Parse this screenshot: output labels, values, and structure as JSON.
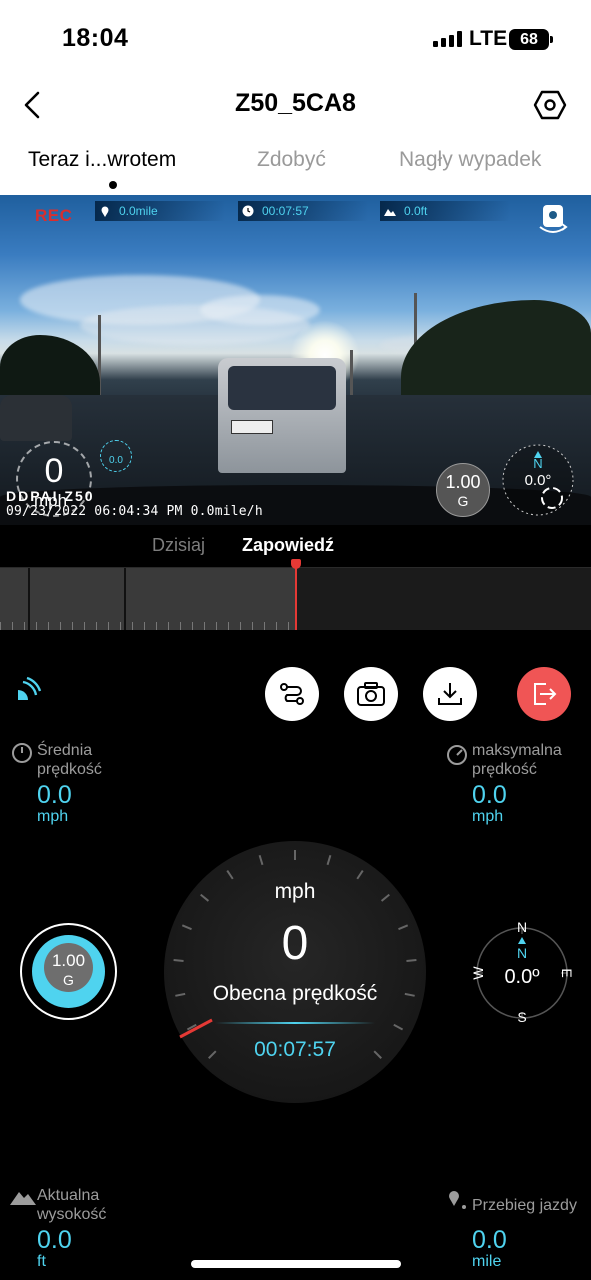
{
  "status_bar": {
    "time": "18:04",
    "network": "LTE",
    "battery": "68"
  },
  "nav": {
    "title": "Z50_5CA8"
  },
  "tabs": [
    {
      "label": "Teraz i...wrotem",
      "active": true
    },
    {
      "label": "Zdobyć",
      "active": false
    },
    {
      "label": "Nagły wypadek",
      "active": false
    }
  ],
  "video": {
    "rec": "REC",
    "distance": "0.0mile",
    "duration": "00:07:57",
    "altitude": "0.0ft",
    "speed_value": "0",
    "speed_unit": "mph",
    "mini_gauge": "0.0",
    "g_value": "1.00",
    "g_unit": "G",
    "compass_value": "0.0°",
    "compass_n": "N",
    "overlay_logo": "DDPAI Z50",
    "overlay_text": "09/23/2022 06:04:34 PM  0.0mile/h"
  },
  "timeline": {
    "tabs": [
      {
        "label": "Dzisiaj",
        "active": false
      },
      {
        "label": "Zapowiedź",
        "active": true
      }
    ]
  },
  "controls": [
    "route",
    "camera",
    "download",
    "exit"
  ],
  "stats": {
    "avg_speed": {
      "label": "Średnia\nprędkość",
      "value": "0.0",
      "unit": "mph"
    },
    "max_speed": {
      "label": "maksymalna\nprędkość",
      "value": "0.0",
      "unit": "mph"
    },
    "altitude": {
      "label": "Aktualna\nwysokość",
      "value": "0.0",
      "unit": "ft"
    },
    "mileage": {
      "label": "Przebieg jazdy",
      "value": "0.0",
      "unit": "mile"
    }
  },
  "gauge": {
    "unit": "mph",
    "value": "0",
    "label": "Obecna prędkość",
    "time": "00:07:57"
  },
  "g_sensor": {
    "value": "1.00",
    "unit": "G"
  },
  "compass": {
    "n": "N",
    "s": "S",
    "e": "E",
    "w": "W",
    "pointer": "N",
    "value": "0.0º"
  },
  "colors": {
    "accent": "#4fd3ef",
    "record": "#d92e2e",
    "exit": "#f05555",
    "needle": "#e53935"
  }
}
